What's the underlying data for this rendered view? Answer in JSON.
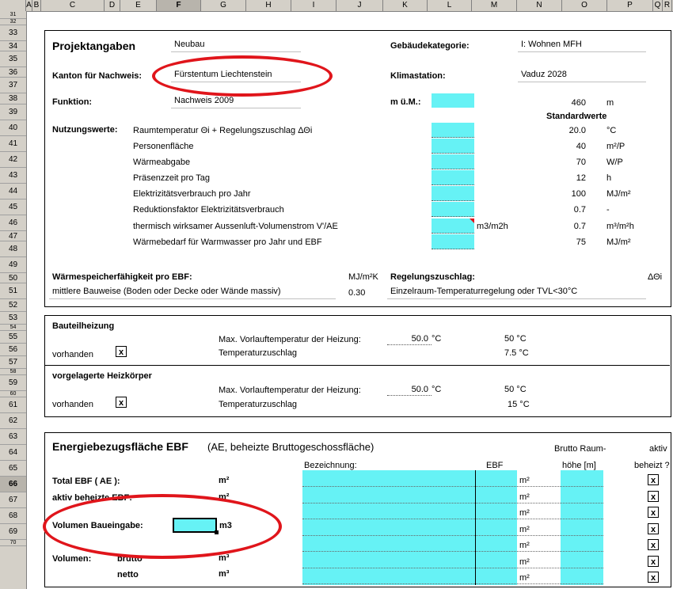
{
  "columns": [
    {
      "label": "A",
      "w": 8
    },
    {
      "label": "B",
      "w": 11
    },
    {
      "label": "C",
      "w": 80
    },
    {
      "label": "D",
      "w": 20
    },
    {
      "label": "E",
      "w": 46
    },
    {
      "label": "F",
      "w": 56
    },
    {
      "label": "G",
      "w": 57
    },
    {
      "label": "H",
      "w": 57
    },
    {
      "label": "I",
      "w": 57
    },
    {
      "label": "J",
      "w": 59
    },
    {
      "label": "K",
      "w": 56
    },
    {
      "label": "L",
      "w": 56
    },
    {
      "label": "M",
      "w": 57
    },
    {
      "label": "N",
      "w": 57
    },
    {
      "label": "O",
      "w": 57
    },
    {
      "label": "P",
      "w": 58
    },
    {
      "label": "Q",
      "w": 12
    },
    {
      "label": "R",
      "w": 12
    }
  ],
  "selected_column": "F",
  "rows": [
    "31",
    "32",
    "33",
    "34",
    "35",
    "36",
    "37",
    "38",
    "39",
    "40",
    "41",
    "42",
    "43",
    "44",
    "45",
    "46",
    "47",
    "48",
    "49",
    "50",
    "51",
    "52",
    "53",
    "54",
    "55",
    "56",
    "57",
    "58",
    "59",
    "60",
    "61",
    "62",
    "63",
    "64",
    "65",
    "66",
    "67",
    "68",
    "69",
    "70"
  ],
  "selected_row": "66",
  "projekt": {
    "title": "Projektangaben",
    "projekt_value": "Neubau",
    "kanton_label": "Kanton für Nachweis:",
    "kanton_value": "Fürstentum Liechtenstein",
    "funktion_label": "Funktion:",
    "funktion_value": "Nachweis 2009",
    "gebaeude_label": "Gebäudekategorie:",
    "gebaeude_value": "I:  Wohnen MFH",
    "klima_label": "Klimastation:",
    "klima_value": "Vaduz  2028",
    "mum_label": "m ü.M.:",
    "mum_value": "460",
    "mum_unit": "m",
    "standardwerte": "Standardwerte"
  },
  "nutzung": {
    "label": "Nutzungswerte:",
    "rows": [
      {
        "label": "Raumtemperatur Θi + Regelungszuschlag  ΔΘi",
        "value": "20.0",
        "unit": "°C"
      },
      {
        "label": "Personenfläche",
        "value": "40",
        "unit": "m²/P"
      },
      {
        "label": "Wärmeabgabe",
        "value": "70",
        "unit": "W/P"
      },
      {
        "label": "Präsenzzeit pro Tag",
        "value": "12",
        "unit": "h"
      },
      {
        "label": "Elektrizitätsverbrauch pro Jahr",
        "value": "100",
        "unit": "MJ/m²"
      },
      {
        "label": "Reduktionsfaktor Elektrizitätsverbrauch",
        "value": "0.7",
        "unit": "-"
      },
      {
        "label": "thermisch wirksamer Aussenluft-Volumenstrom V'/AE",
        "value": "0.7",
        "unit": "m³/m²h",
        "mid_unit": "m3/m2h"
      },
      {
        "label": "Wärmebedarf für Warmwasser pro Jahr und EBF",
        "value": "75",
        "unit": "MJ/m²"
      }
    ]
  },
  "waerme": {
    "label": "Wärmespeicherfähigkeit pro EBF:",
    "unit": "MJ/m²K",
    "bauweise": "mittlere Bauweise (Boden oder Decke oder Wände massiv)",
    "value": "0.30",
    "regel_label": "Regelungszuschlag:",
    "regel_symbol": "ΔΘi",
    "regel_value": "Einzelraum-Temperaturregelung oder TVL<30°C"
  },
  "bauteil": {
    "title": "Bauteilheizung",
    "max_label": "Max. Vorlauftemperatur der Heizung:",
    "max_input": "50.0",
    "max_unit": "°C",
    "max_value": "50 °C",
    "vorhanden": "vorhanden",
    "check": "x",
    "zuschlag_label": "Temperaturzuschlag",
    "zuschlag_value": "7.5 °C"
  },
  "heizkoerper": {
    "title": "vorgelagerte Heizkörper",
    "max_label": "Max. Vorlauftemperatur der Heizung:",
    "max_input": "50.0",
    "max_unit": "°C",
    "max_value": "50 °C",
    "vorhanden": "vorhanden",
    "check": "x",
    "zuschlag_label": "Temperaturzuschlag",
    "zuschlag_value": "15 °C"
  },
  "ebf": {
    "title": "Energiebezugsfläche EBF",
    "subtitle": "(AE, beheizte Bruttogeschossfläche)",
    "brutto_raum": "Brutto Raum-",
    "aktiv": "aktiv",
    "bezeichnung": "Bezeichnung:",
    "ebf_col": "EBF",
    "hoehe": "höhe [m]",
    "beheizt": "beheizt ?",
    "total_label": "Total EBF ( AE ):",
    "aktiv_label": "aktiv beheizte EBF:",
    "volumen_label": "Volumen Baueingabe:",
    "volumen_unit": "m3",
    "m2": "m²",
    "m3": "m³",
    "volumen": "Volumen:",
    "brutto": "brutto",
    "netto": "netto",
    "row_unit": "m²",
    "row_check": "x"
  },
  "colors": {
    "input_cyan": "#66f2f5",
    "annotation_red": "#e0151b",
    "header_gray": "#d4d0c8"
  }
}
